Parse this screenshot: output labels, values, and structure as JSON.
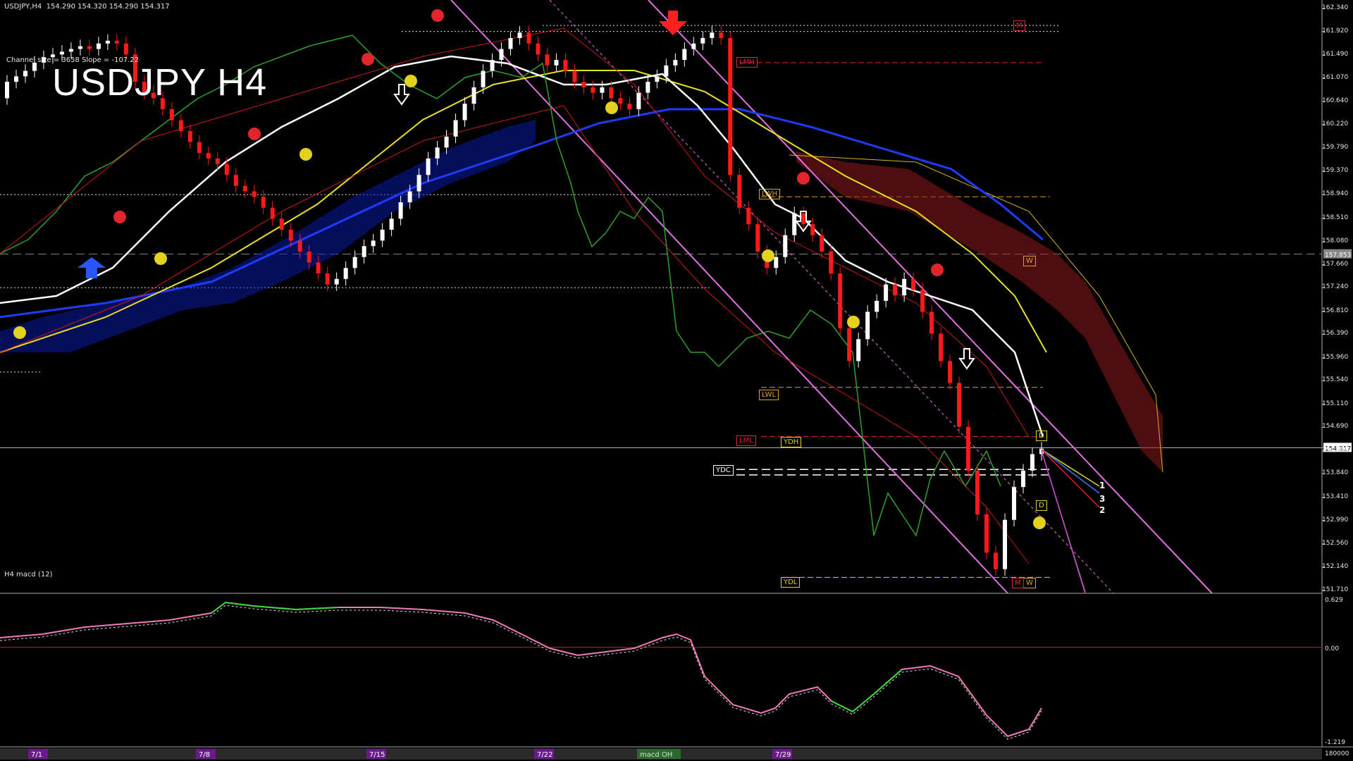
{
  "header": {
    "symbol_line": "USDJPY,H4  154.290 154.320 154.290 154.317",
    "channel_info": "Channel size = 3658 Slope = -107.22",
    "title": "USDJPY H4"
  },
  "macd": {
    "label": "H4  macd (12)",
    "ticks": [
      "0.629",
      "0.00",
      "-1.219"
    ],
    "bottom_label": "180000"
  },
  "price_axis": [
    "162.340",
    "161.920",
    "161.490",
    "161.070",
    "160.640",
    "160.220",
    "159.790",
    "159.370",
    "158.940",
    "158.510",
    "158.080",
    "157.660",
    "157.240",
    "156.810",
    "156.390",
    "155.960",
    "155.540",
    "155.110",
    "154.690",
    "154.260",
    "153.840",
    "153.410",
    "152.990",
    "152.560",
    "152.140",
    "151.710"
  ],
  "axis_tags": {
    "current": "154.317",
    "hline": "157.853"
  },
  "date_axis": [
    "7/1",
    "7/8",
    "7/15",
    "7/22",
    "7/29"
  ],
  "bottom_tab": "macd OH",
  "levels": [
    {
      "text": "M",
      "color": "#e0262b"
    },
    {
      "text": "LMH",
      "color": "#e0262b"
    },
    {
      "text": "LWH",
      "color": "#d9a030"
    },
    {
      "text": "W",
      "color": "#d9a030"
    },
    {
      "text": "LWL",
      "color": "#d9a030"
    },
    {
      "text": "LML",
      "color": "#e0262b"
    },
    {
      "text": "YDH",
      "color": "#e2d21e"
    },
    {
      "text": "YDC",
      "color": "#ffffff"
    },
    {
      "text": "D",
      "color": "#e2d21e"
    },
    {
      "text": "D",
      "color": "#e2d21e"
    },
    {
      "text": "YDL",
      "color": "#e2d21e"
    },
    {
      "text": "W",
      "color": "#d9a030"
    },
    {
      "text": "M",
      "color": "#e0262b"
    }
  ],
  "projection_labels": [
    "1",
    "3",
    "2"
  ],
  "colors": {
    "bull": "#ffffff",
    "bear": "#ff1a1a",
    "ma_white": "#ffffff",
    "ma_yellow": "#e8e020",
    "ma_blue": "#1e3cff",
    "channel": "#e070e0",
    "cloud_blue": "#1e3cff",
    "cloud_red": "#cc2b2b",
    "macd_green": "#35d935",
    "macd_pink": "#f07ab8"
  },
  "chart_data": {
    "type": "candlestick",
    "title": "USDJPY H4",
    "ylim": [
      151.71,
      162.34
    ],
    "x": [
      "7/1",
      "7/8",
      "7/15",
      "7/22",
      "7/29"
    ],
    "series": [
      {
        "name": "USDJPY,H4",
        "close_path": [
          161.0,
          161.1,
          161.2,
          161.35,
          161.45,
          161.5,
          161.55,
          161.6,
          161.65,
          161.6,
          161.7,
          161.75,
          161.7,
          161.5,
          161.0,
          160.8,
          160.7,
          160.5,
          160.3,
          160.1,
          159.9,
          159.7,
          159.6,
          159.5,
          159.3,
          159.1,
          159.0,
          158.9,
          158.7,
          158.5,
          158.3,
          158.1,
          157.9,
          157.7,
          157.5,
          157.3,
          157.4,
          157.6,
          157.8,
          158.0,
          158.1,
          158.3,
          158.5,
          158.8,
          159.0,
          159.3,
          159.6,
          159.8,
          160.0,
          160.3,
          160.6,
          160.9,
          161.2,
          161.4,
          161.6,
          161.8,
          161.9,
          161.7,
          161.5,
          161.3,
          161.4,
          161.2,
          161.0,
          160.9,
          160.8,
          160.9,
          160.7,
          160.6,
          160.5,
          160.8,
          161.0,
          161.1,
          161.3,
          161.4,
          161.6,
          161.7,
          161.8,
          161.9,
          161.8,
          159.3,
          158.7,
          158.4,
          157.9,
          157.6,
          157.8,
          158.2,
          158.6,
          158.4,
          158.2,
          157.9,
          157.5,
          156.5,
          155.9,
          156.3,
          156.8,
          157.0,
          157.3,
          157.1,
          157.4,
          157.2,
          156.8,
          156.4,
          155.9,
          155.5,
          154.7,
          153.9,
          153.1,
          152.4,
          152.1,
          153.0,
          153.6,
          153.9,
          154.2,
          154.3
        ]
      }
    ],
    "macd_range": [
      -1.219,
      0.629
    ]
  }
}
